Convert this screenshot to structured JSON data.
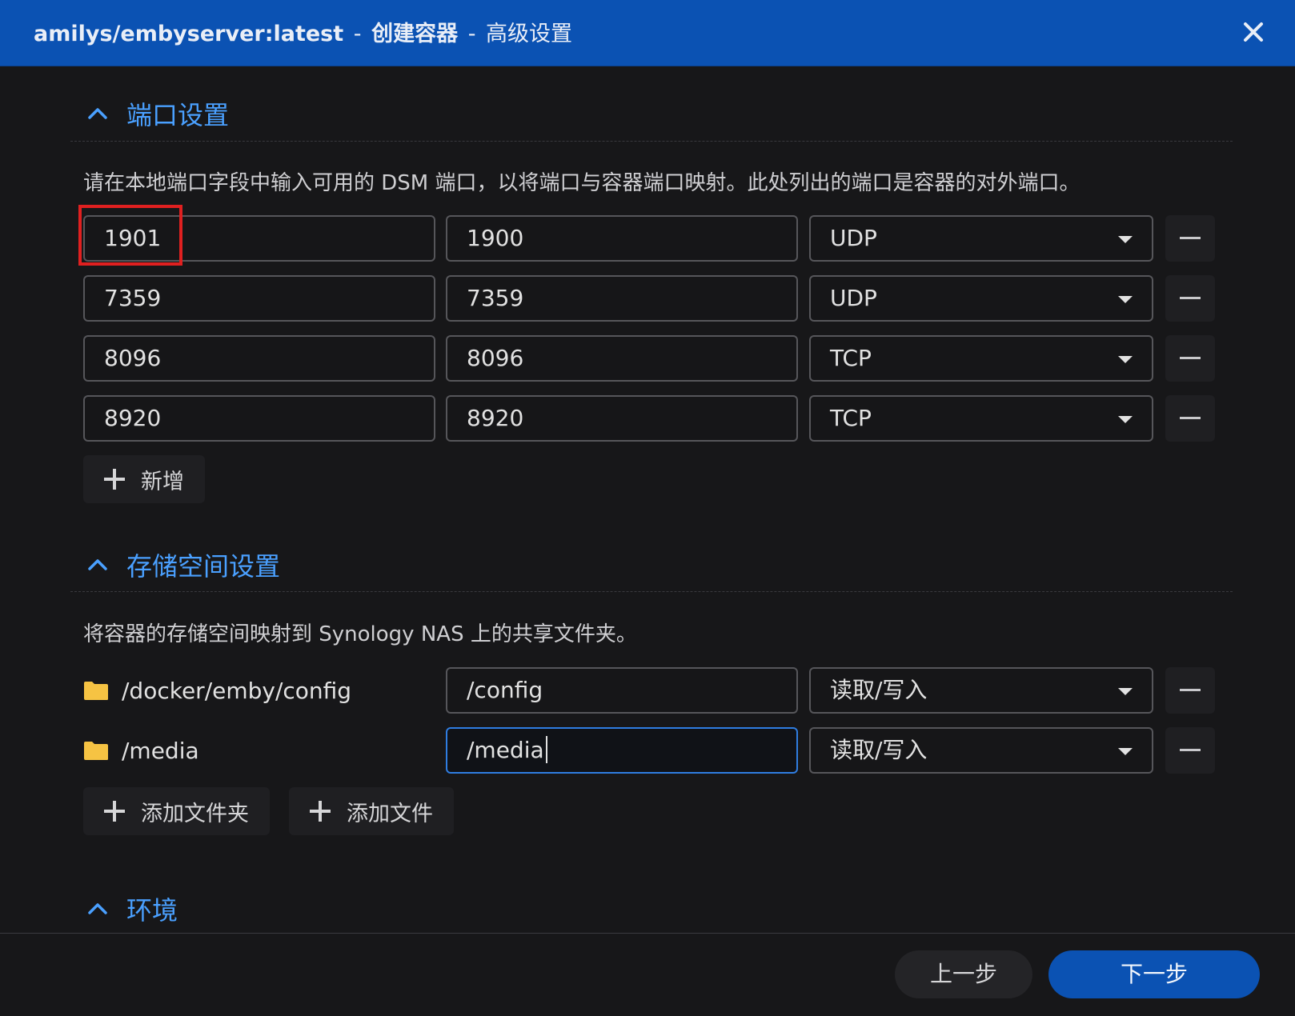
{
  "window": {
    "title_image": "amilys/embyserver:latest",
    "title_action": "创建容器",
    "title_step": "高级设置",
    "title_sep1": "-",
    "title_sep2": "-",
    "close_icon": "close-icon"
  },
  "ports": {
    "heading": "端口设置",
    "description": "请在本地端口字段中输入可用的 DSM 端口，以将端口与容器端口映射。此处列出的端口是容器的对外端口。",
    "rows": [
      {
        "local": "1901",
        "container": "1900",
        "protocol": "UDP"
      },
      {
        "local": "7359",
        "container": "7359",
        "protocol": "UDP"
      },
      {
        "local": "8096",
        "container": "8096",
        "protocol": "TCP"
      },
      {
        "local": "8920",
        "container": "8920",
        "protocol": "TCP"
      }
    ],
    "add_label": "新增"
  },
  "storage": {
    "heading": "存储空间设置",
    "description": "将容器的存储空间映射到 Synology NAS 上的共享文件夹。",
    "rows": [
      {
        "host_path": "/docker/emby/config",
        "mount_path": "/config",
        "permission": "读取/写入"
      },
      {
        "host_path": "/media",
        "mount_path": "/media",
        "permission": "读取/写入"
      }
    ],
    "add_folder_label": "添加文件夹",
    "add_file_label": "添加文件"
  },
  "environment": {
    "heading": "环境"
  },
  "footer": {
    "prev_label": "上一步",
    "next_label": "下一步"
  },
  "colors": {
    "titlebar": "#0b52b3",
    "accent": "#4aa0ff",
    "background": "#171719",
    "highlight": "#e02020",
    "folder": "#f6c343"
  }
}
